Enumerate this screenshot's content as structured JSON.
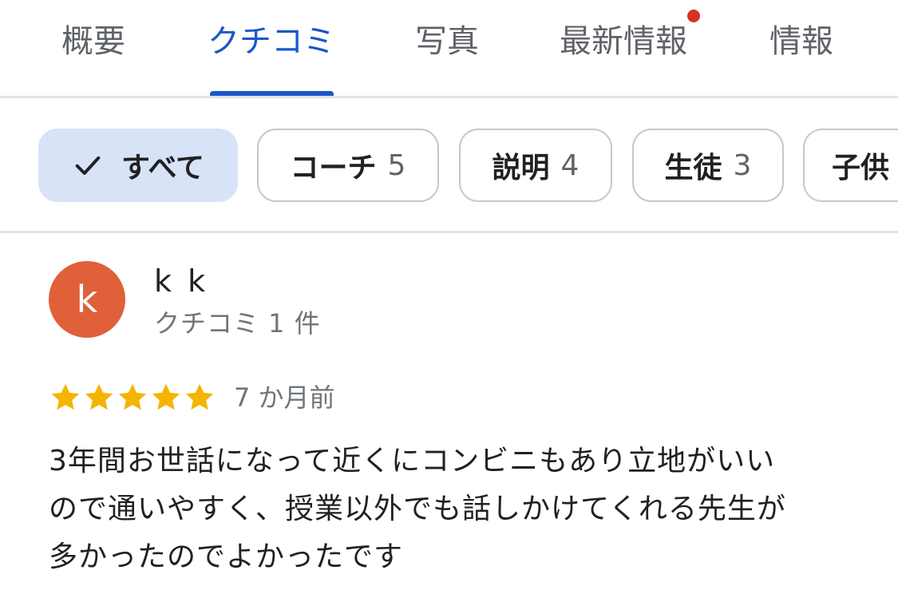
{
  "tabs": [
    {
      "label": "概要"
    },
    {
      "label": "クチコミ"
    },
    {
      "label": "写真"
    },
    {
      "label": "最新情報"
    },
    {
      "label": "情報"
    }
  ],
  "active_tab": "クチコミ",
  "filters": {
    "all": "すべて",
    "chips": [
      {
        "label": "コーチ",
        "count": "5"
      },
      {
        "label": "説明",
        "count": "4"
      },
      {
        "label": "生徒",
        "count": "3"
      },
      {
        "label": "子供"
      }
    ]
  },
  "review": {
    "avatar_letter": "k",
    "avatar_color": "#e0603a",
    "name": "k k",
    "reviewer_review_count": "クチコミ 1 件",
    "rating": 5,
    "date": "7 か月前",
    "text_lines": [
      "3年間お世話になって近くにコンビニもあり立地がいい",
      "ので通いやすく、授業以外でも話しかけてくれる先生が",
      "多かったのでよかったです"
    ]
  },
  "colors": {
    "accent": "#1a57c9",
    "selected_chip": "#d8e3f8",
    "star": "#f4b400",
    "notification_dot": "#d93025"
  },
  "icons": {
    "check": "check-icon",
    "star": "star-icon"
  }
}
